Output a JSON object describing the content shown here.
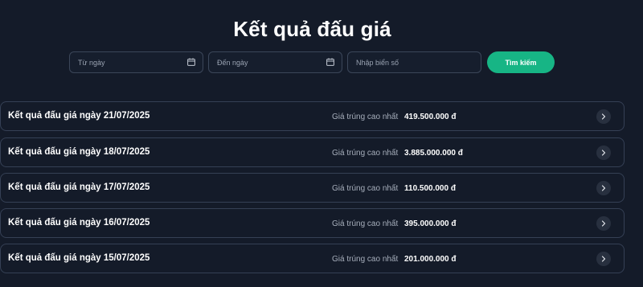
{
  "page": {
    "title": "Kết quả đấu giá"
  },
  "filters": {
    "from_date_placeholder": "Từ ngày",
    "to_date_placeholder": "Đến ngày",
    "plate_placeholder": "Nhập biển số",
    "search_label": "Tìm kiếm"
  },
  "colors": {
    "background": "#141b29",
    "accent": "#17b585",
    "border": "#354055"
  },
  "results": [
    {
      "label": "Kết quả đấu giá ngày 21/07/2025",
      "price_label": "Giá trúng cao nhất",
      "price": "419.500.000 đ",
      "icon": "chevron-right-icon"
    },
    {
      "label": "Kết quả đấu giá ngày 18/07/2025",
      "price_label": "Giá trúng cao nhất",
      "price": "3.885.000.000 đ",
      "icon": "chevron-right-icon"
    },
    {
      "label": "Kết quả đấu giá ngày 17/07/2025",
      "price_label": "Giá trúng cao nhất",
      "price": "110.500.000 đ",
      "icon": "chevron-right-icon"
    },
    {
      "label": "Kết quả đấu giá ngày 16/07/2025",
      "price_label": "Giá trúng cao nhất",
      "price": "395.000.000 đ",
      "icon": "chevron-right-icon"
    },
    {
      "label": "Kết quả đấu giá ngày 15/07/2025",
      "price_label": "Giá trúng cao nhất",
      "price": "201.000.000 đ",
      "icon": "chevron-right-icon"
    }
  ]
}
